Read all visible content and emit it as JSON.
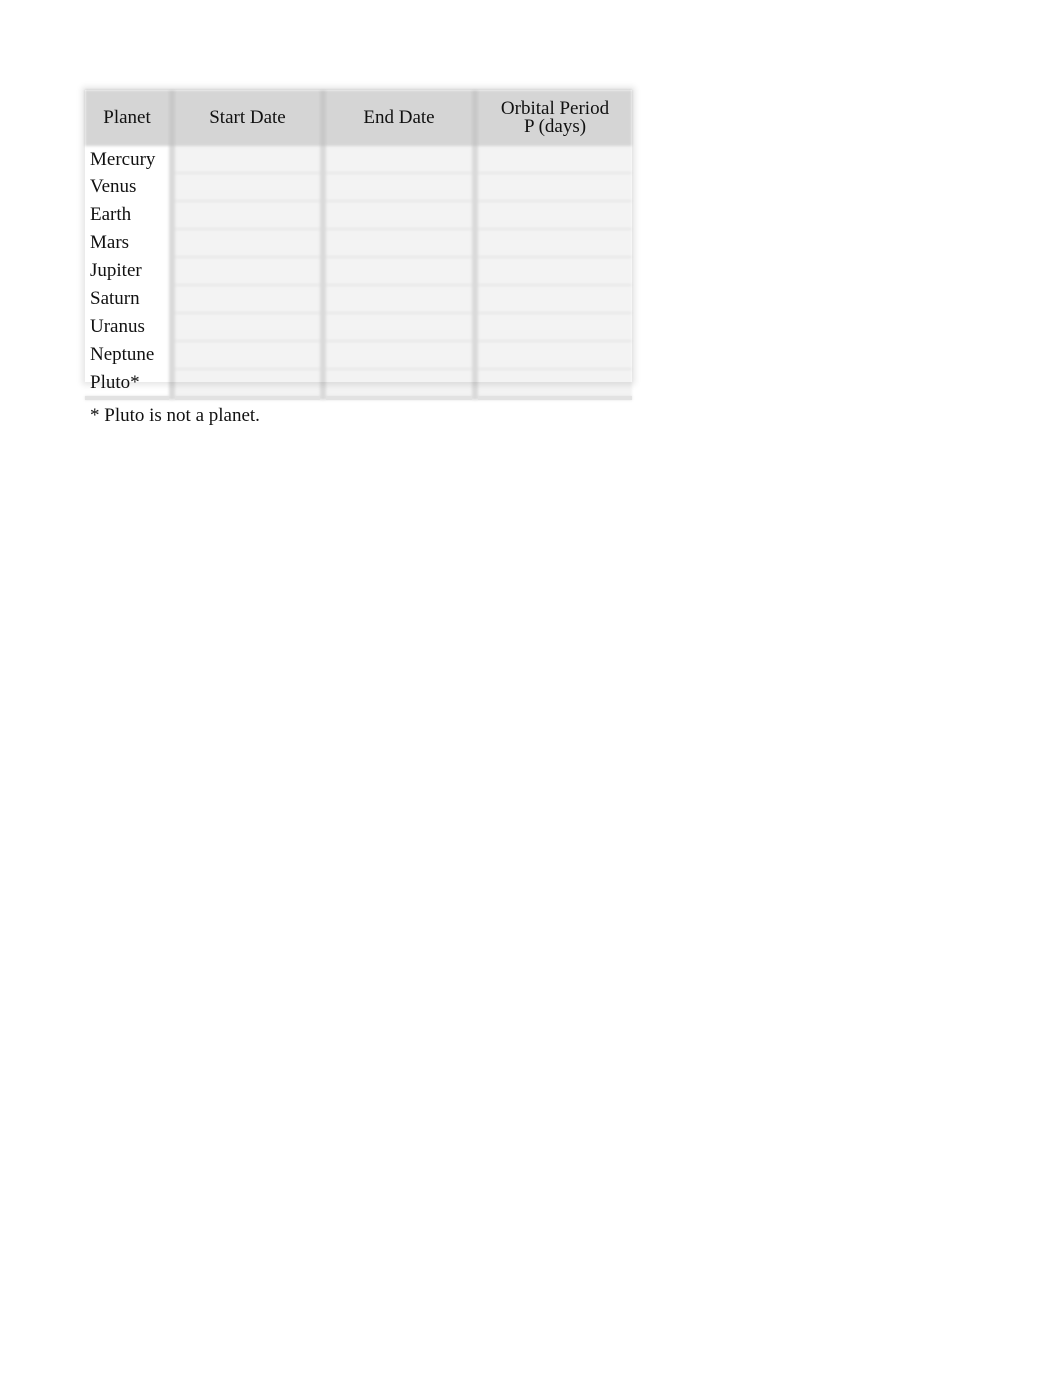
{
  "table": {
    "headers": [
      {
        "line1": "Planet",
        "line2": ""
      },
      {
        "line1": "Start Date",
        "line2": ""
      },
      {
        "line1": "End Date",
        "line2": ""
      },
      {
        "line1": "Orbital Period",
        "line2": "P (days)"
      }
    ],
    "rows": [
      {
        "planet": "Mercury",
        "start_date": "",
        "end_date": "",
        "orbital_period": ""
      },
      {
        "planet": "Venus",
        "start_date": "",
        "end_date": "",
        "orbital_period": ""
      },
      {
        "planet": "Earth",
        "start_date": "",
        "end_date": "",
        "orbital_period": ""
      },
      {
        "planet": "Mars",
        "start_date": "",
        "end_date": "",
        "orbital_period": ""
      },
      {
        "planet": "Jupiter",
        "start_date": "",
        "end_date": "",
        "orbital_period": ""
      },
      {
        "planet": "Saturn",
        "start_date": "",
        "end_date": "",
        "orbital_period": ""
      },
      {
        "planet": "Uranus",
        "start_date": "",
        "end_date": "",
        "orbital_period": ""
      },
      {
        "planet": "Neptune",
        "start_date": "",
        "end_date": "",
        "orbital_period": ""
      },
      {
        "planet": "Pluto*",
        "start_date": "",
        "end_date": "",
        "orbital_period": ""
      }
    ]
  },
  "footnote": "* Pluto is not a planet."
}
